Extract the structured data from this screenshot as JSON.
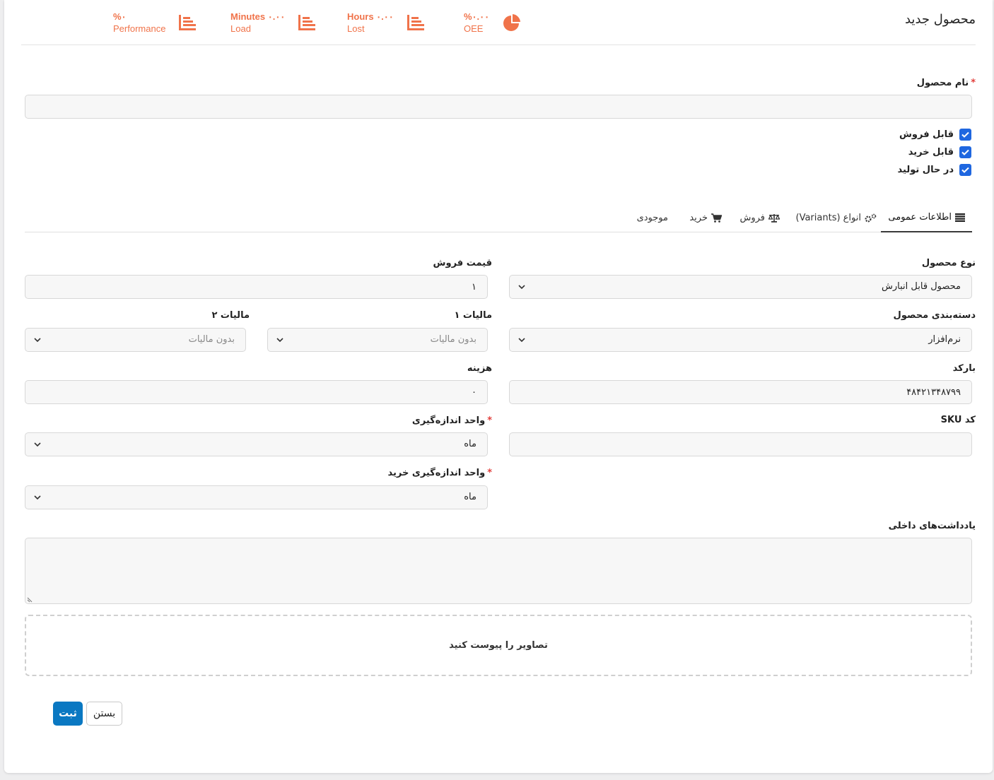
{
  "header": {
    "title": "محصول جدید",
    "stats": [
      {
        "value": "%۰",
        "label": "Performance"
      },
      {
        "value": "Minutes ۰.۰۰",
        "label": "Load"
      },
      {
        "value": "Hours ۰.۰۰",
        "label": "Lost"
      },
      {
        "value": "%۰.۰۰",
        "label": "OEE"
      }
    ],
    "accent_color": "#f0734a"
  },
  "form": {
    "product_name": {
      "label": "نام محصول",
      "required": "*",
      "value": ""
    },
    "checkboxes": [
      {
        "label": "قابل فروش",
        "checked": true
      },
      {
        "label": "قابل خرید",
        "checked": true
      },
      {
        "label": "در حال تولید",
        "checked": true
      }
    ]
  },
  "tabs": [
    {
      "label": "اطلاعات عمومی",
      "icon": "list-icon",
      "active": true
    },
    {
      "label": "انواع (Variants)",
      "icon": "gears-icon"
    },
    {
      "label": "فروش",
      "icon": "scale-icon"
    },
    {
      "label": "خرید",
      "icon": "cart-icon"
    },
    {
      "label": "موجودی",
      "icon": ""
    }
  ],
  "general": {
    "product_type": {
      "label": "نوع محصول",
      "value": "محصول قابل انبارش"
    },
    "sale_price": {
      "label": "قیمت فروش",
      "value": "۱"
    },
    "category": {
      "label": "دسته‌بندی محصول",
      "value": "نرم‌افزار"
    },
    "tax1": {
      "label": "مالیات ۱",
      "placeholder": "بدون مالیات"
    },
    "tax2": {
      "label": "مالیات ۲",
      "placeholder": "بدون مالیات"
    },
    "barcode": {
      "label": "بارکد",
      "value": "۴۸۴۲۱۳۴۸۷۹۹"
    },
    "cost": {
      "label": "هزینه",
      "value": "۰"
    },
    "sku": {
      "label": "کد SKU",
      "value": ""
    },
    "uom": {
      "label": "واحد اندازه‌گیری",
      "required": "*",
      "value": "ماه"
    },
    "purchase_uom": {
      "label": "واحد اندازه‌گیری خرید",
      "required": "*",
      "value": "ماه"
    },
    "notes": {
      "label": "یادداشت‌های داخلی",
      "value": ""
    },
    "dropzone": "تصاویر را پیوست کنید"
  },
  "actions": {
    "submit": "ثبت",
    "close": "بستن"
  }
}
